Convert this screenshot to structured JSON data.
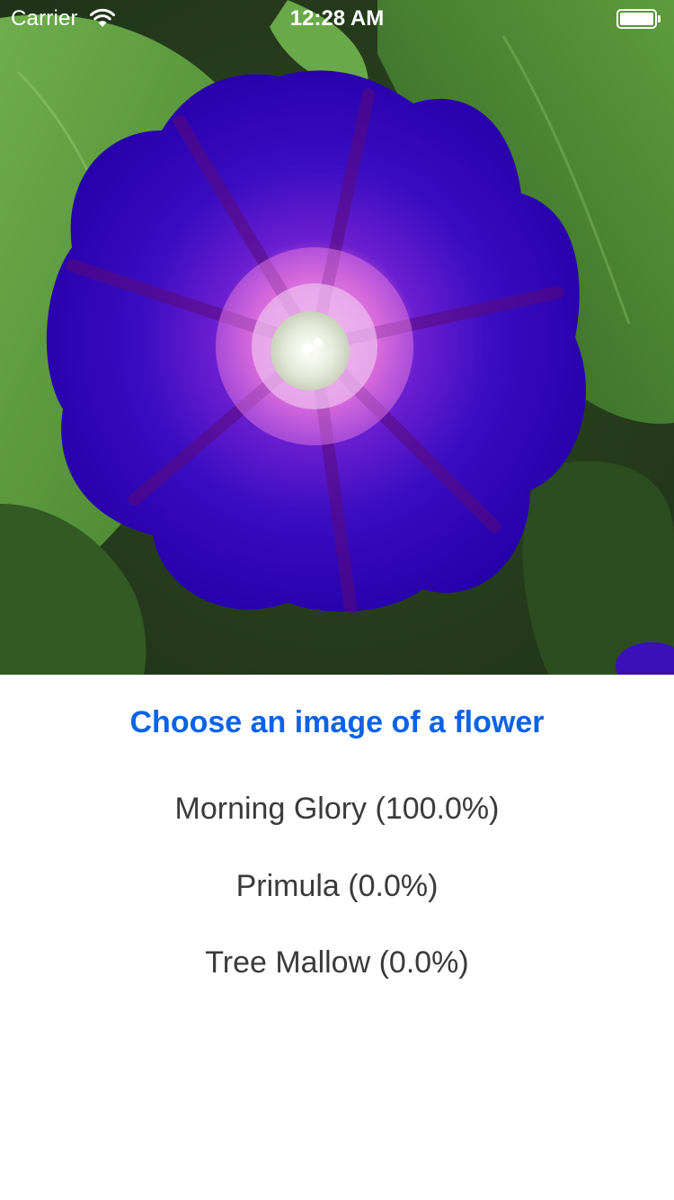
{
  "status_bar": {
    "carrier": "Carrier",
    "time": "12:28 AM"
  },
  "photo": {
    "subject": "purple morning glory flower on green leaves"
  },
  "choose_button": {
    "label": "Choose an image of a flower"
  },
  "results": [
    {
      "label": "Morning Glory (100.0%)"
    },
    {
      "label": "Primula (0.0%)"
    },
    {
      "label": "Tree Mallow (0.0%)"
    }
  ],
  "colors": {
    "accent": "#0a63e6",
    "text": "#3a3a3a",
    "flower": "#3a00b8"
  }
}
